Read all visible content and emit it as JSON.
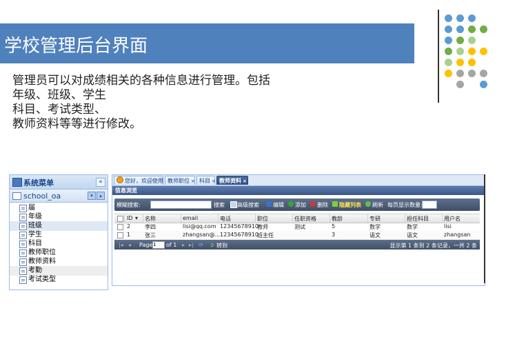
{
  "slide": {
    "title": "学校管理后台界面",
    "description": [
      "管理员可以对成绩相关的各种信息进行管理。包括",
      "年级、班级、学生",
      "科目、考试类型、",
      "教师资料等等进行修改。"
    ]
  },
  "colors": {
    "title_bar": "#4f81bd",
    "dot_blue": "#5b9bd5",
    "dot_green": "#70ad47",
    "dot_lightgreen": "#a9d18e",
    "dot_yellow": "#ffc000",
    "dot_gray": "#a5a5a5"
  },
  "sidebar": {
    "header": "系统菜单",
    "root": "school_oa",
    "items": [
      "届",
      "年级",
      "班级",
      "学生",
      "科目",
      "教师职位",
      "教师资料",
      "考勤",
      "考试类型"
    ],
    "selected_item": "班级"
  },
  "tabs": [
    {
      "label": "您好，欢迎使用"
    },
    {
      "label": "教师职位"
    },
    {
      "label": "科目"
    },
    {
      "label": "教师资料"
    }
  ],
  "panel": {
    "title": "信息浏览"
  },
  "toolbar": {
    "search_label": "模糊搜索:",
    "search_button": "搜索",
    "advanced_search": "高级搜索",
    "edit": "编辑",
    "add": "添加",
    "delete": "删除",
    "hide_columns": "隐藏列表",
    "refresh": "刷新",
    "per_page_label": "每页显示数量:"
  },
  "grid": {
    "columns": [
      "ID",
      "名称",
      "email",
      "电话",
      "职位",
      "任职资格",
      "教龄",
      "专研",
      "担任科目",
      "用户名"
    ],
    "rows": [
      [
        "2",
        "李四",
        "lisi@qq.com",
        "12345678910",
        "教师",
        "测试",
        "5",
        "数学",
        "数学",
        "lisi"
      ],
      [
        "1",
        "张三",
        "zhangsan@...",
        "12345678910",
        "班主任",
        "",
        "3",
        "语文",
        "语文",
        "zhangsan"
      ]
    ]
  },
  "pager": {
    "page_label": "Page",
    "page_value": "1",
    "of_label": "of 1",
    "goto": "转到",
    "summary": "显示第 1 条到 2 条记录，一共 2 条"
  }
}
